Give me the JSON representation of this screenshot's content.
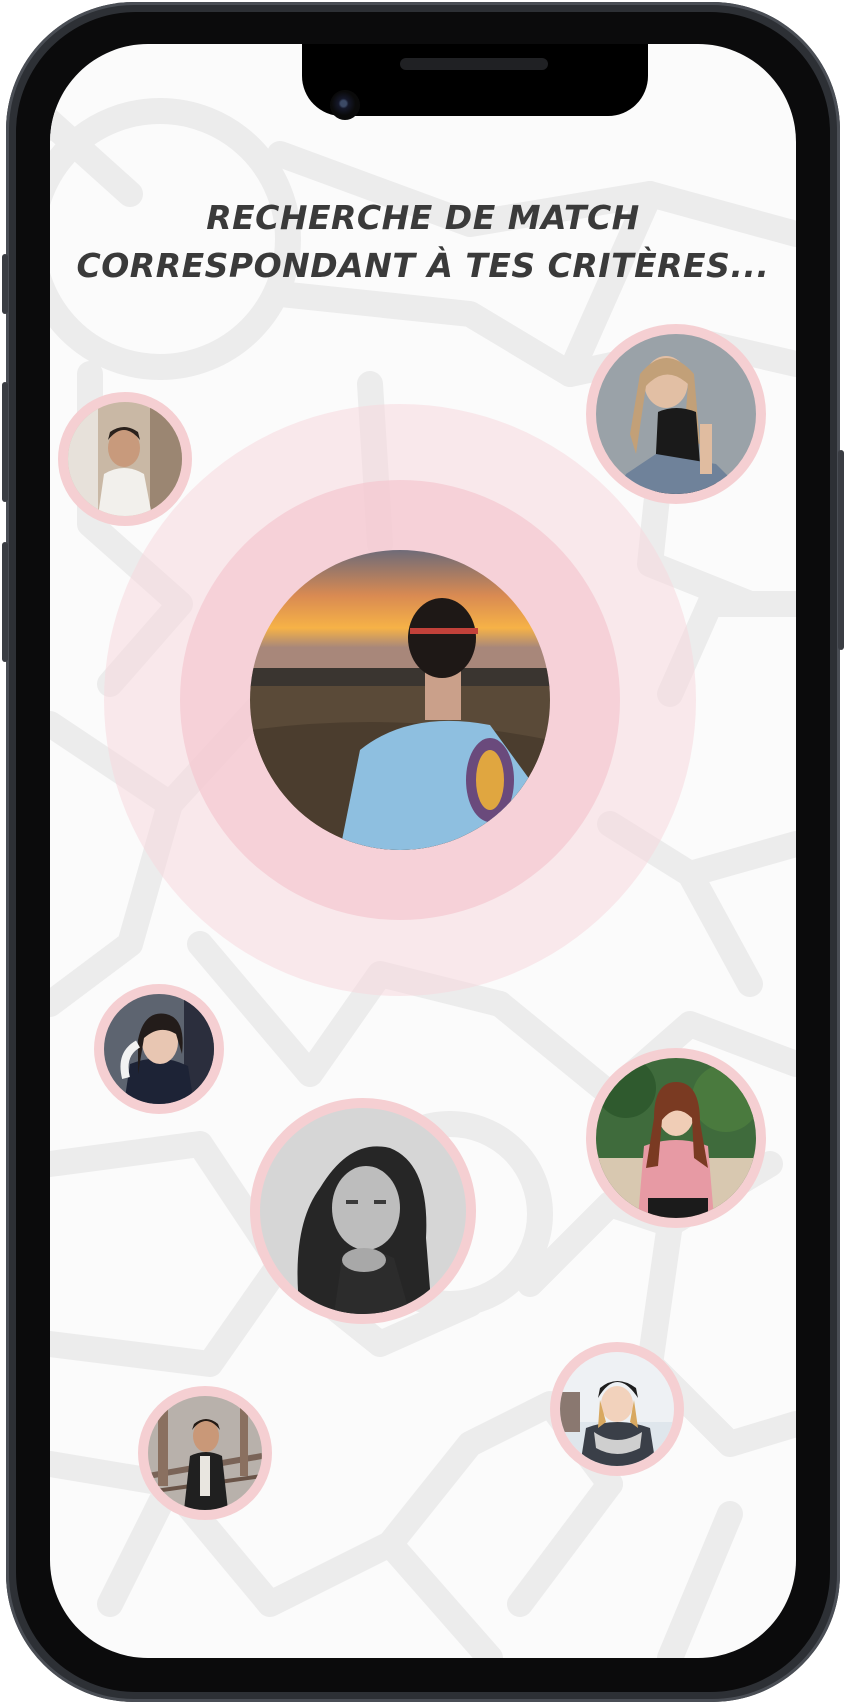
{
  "screen": {
    "headline_line1": "RECHERCHE DE MATCH",
    "headline_line2": "CORRESPONDANT À TES CRITÈRES..."
  },
  "colors": {
    "ring_outer": "#fbeaec",
    "ring_inner": "#f7d3d9",
    "avatar_border": "#f5cfd2",
    "headline": "#3a3a3a",
    "map_roads": "#ececec"
  },
  "profiles": [
    {
      "id": "center-user",
      "kind": "man-sunset"
    },
    {
      "id": "top-left",
      "kind": "man-doorway"
    },
    {
      "id": "top-right",
      "kind": "woman-black-top"
    },
    {
      "id": "middle-left",
      "kind": "woman-portrait"
    },
    {
      "id": "middle-right",
      "kind": "woman-pink-sweater"
    },
    {
      "id": "center-bottom",
      "kind": "woman-bw"
    },
    {
      "id": "bottom-left",
      "kind": "man-bridge"
    },
    {
      "id": "bottom-right",
      "kind": "woman-beanie"
    }
  ]
}
